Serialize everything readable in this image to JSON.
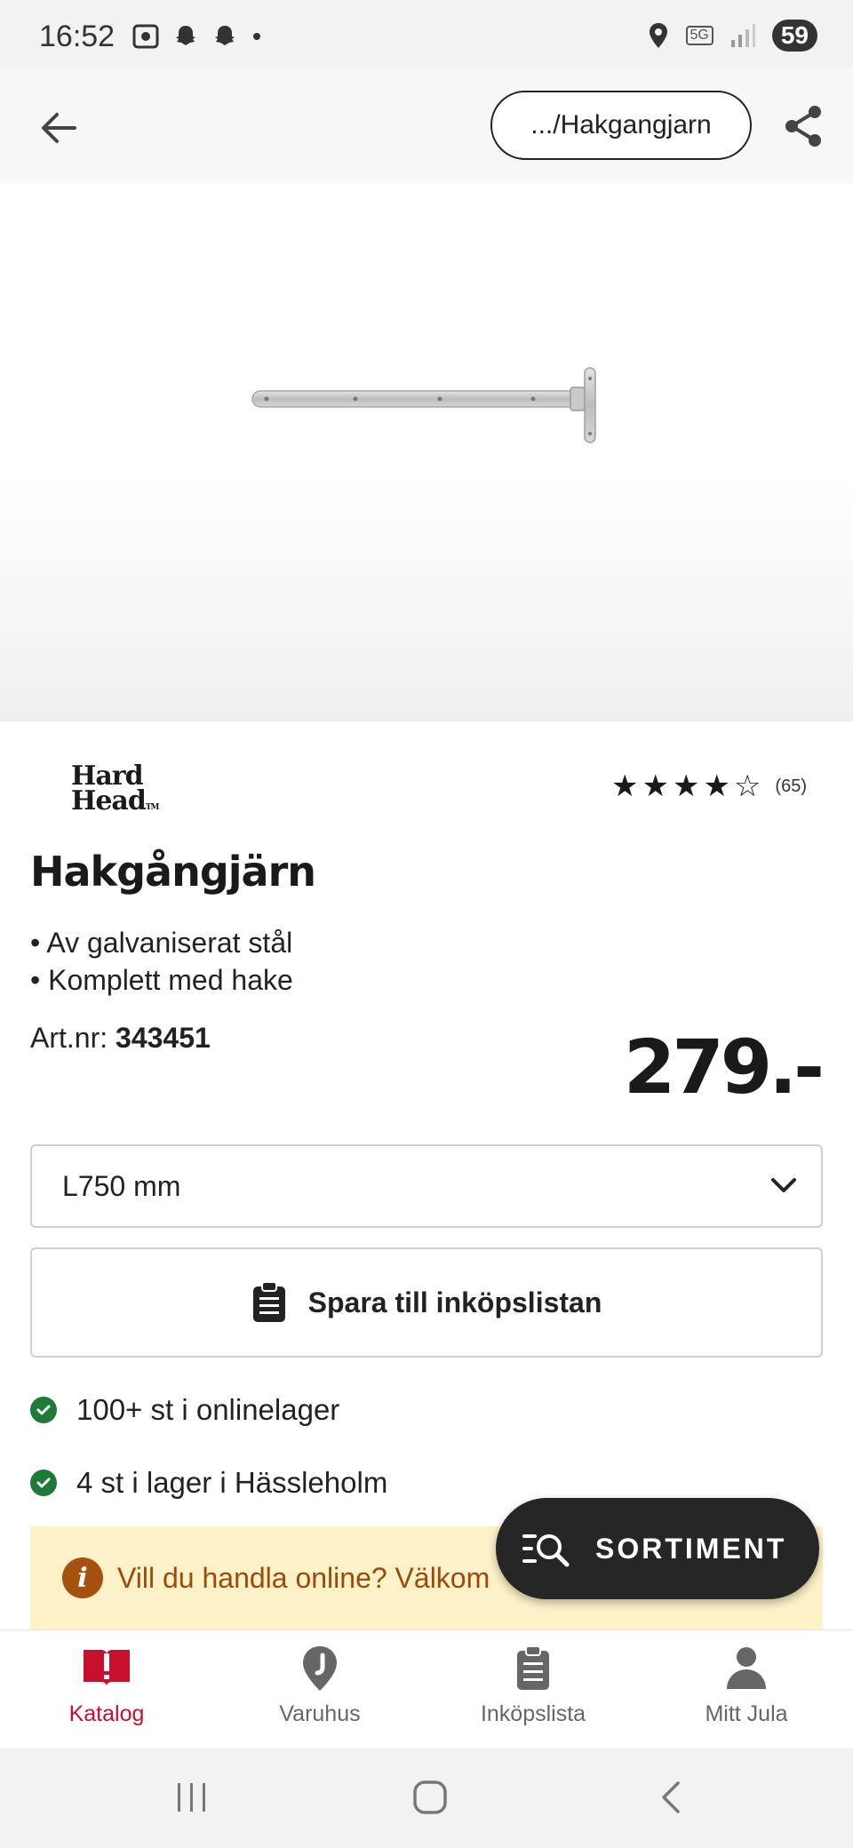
{
  "status_bar": {
    "time": "16:52",
    "network": "5G",
    "battery": "59"
  },
  "header": {
    "breadcrumb": ".../Hakgangjarn"
  },
  "product": {
    "brand": [
      "Hard",
      "Head"
    ],
    "brand_tm": "TM",
    "rating": 4,
    "rating_max": 5,
    "review_count": "(65)",
    "title": "Hakgångjärn",
    "bullets": [
      "• Av galvaniserat stål",
      "• Komplett med hake"
    ],
    "artnr_label": "Art.nr:",
    "artnr_value": "343451",
    "price": "279.-"
  },
  "variant": {
    "selected": "L750 mm"
  },
  "save_button": {
    "label": "Spara till inköpslistan"
  },
  "stock": {
    "online": "100+ st i onlinelager",
    "store": "4 st i lager i Hässleholm"
  },
  "info_banner": {
    "text": "Vill du handla online? Välkom"
  },
  "fab": {
    "label": "SORTIMENT"
  },
  "bottom_nav": {
    "items": [
      {
        "label": "Katalog",
        "icon": "catalog-icon",
        "active": true
      },
      {
        "label": "Varuhus",
        "icon": "location-pin-icon",
        "active": false
      },
      {
        "label": "Inköpslista",
        "icon": "clipboard-icon",
        "active": false
      },
      {
        "label": "Mitt Jula",
        "icon": "user-icon",
        "active": false
      }
    ]
  },
  "colors": {
    "accent": "#c8102e",
    "success": "#1f7a3a",
    "banner_bg": "#fdf2c7",
    "banner_text": "#9b4a0d",
    "fab_bg": "#262626"
  }
}
